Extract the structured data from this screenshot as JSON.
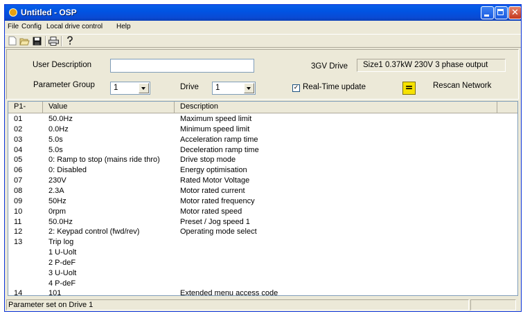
{
  "window": {
    "title": "Untitled - OSP",
    "icon": "osp-app-icon",
    "controls": [
      "minimize",
      "maximize",
      "close"
    ]
  },
  "menu": [
    "File",
    "Config",
    "Local drive control",
    "Help"
  ],
  "toolbar": {
    "buttons": [
      "new-icon",
      "open-icon",
      "save-icon",
      "print-icon",
      "help-icon"
    ]
  },
  "form": {
    "user_description_label": "User Description",
    "user_description_value": "",
    "drive_type": "3GV Drive",
    "drive_size": "Size1 0.37kW 230V 3 phase output",
    "parameter_group_label": "Parameter Group",
    "parameter_group_value": "1",
    "drive_label": "Drive",
    "drive_value": "1",
    "realtime_label": "Real-Time update",
    "realtime_checked": true,
    "rescan_button_glyph": "=",
    "rescan_label": "Rescan Network"
  },
  "table": {
    "columns": [
      "P1-",
      "Value",
      "Description"
    ],
    "rows": [
      {
        "p": "01",
        "value": "50.0Hz",
        "desc": "Maximum speed limit"
      },
      {
        "p": "02",
        "value": "0.0Hz",
        "desc": "Minimum speed limit"
      },
      {
        "p": "03",
        "value": "5.0s",
        "desc": "Acceleration ramp time"
      },
      {
        "p": "04",
        "value": "5.0s",
        "desc": "Deceleration ramp time"
      },
      {
        "p": "05",
        "value": "0: Ramp to stop (mains ride thro)",
        "desc": "Drive stop mode"
      },
      {
        "p": "06",
        "value": "0: Disabled",
        "desc": "Energy optimisation"
      },
      {
        "p": "07",
        "value": "230V",
        "desc": "Rated Motor Voltage"
      },
      {
        "p": "08",
        "value": "2.3A",
        "desc": "Motor rated current"
      },
      {
        "p": "09",
        "value": "50Hz",
        "desc": "Motor rated frequency"
      },
      {
        "p": "10",
        "value": "0rpm",
        "desc": "Motor rated speed"
      },
      {
        "p": "11",
        "value": "50.0Hz",
        "desc": "Preset / Jog speed 1"
      },
      {
        "p": "12",
        "value": "2: Keypad control (fwd/rev)",
        "desc": "Operating mode select"
      },
      {
        "p": "13",
        "value": "Trip log",
        "desc": ""
      },
      {
        "p": "",
        "value": "1 U-Uolt",
        "desc": ""
      },
      {
        "p": "",
        "value": "2 P-deF",
        "desc": ""
      },
      {
        "p": "",
        "value": "3 U-Uolt",
        "desc": ""
      },
      {
        "p": "",
        "value": "4 P-deF",
        "desc": ""
      },
      {
        "p": "14",
        "value": "101",
        "desc": "Extended menu access code"
      }
    ]
  },
  "status": {
    "message": "Parameter set on Drive 1"
  }
}
